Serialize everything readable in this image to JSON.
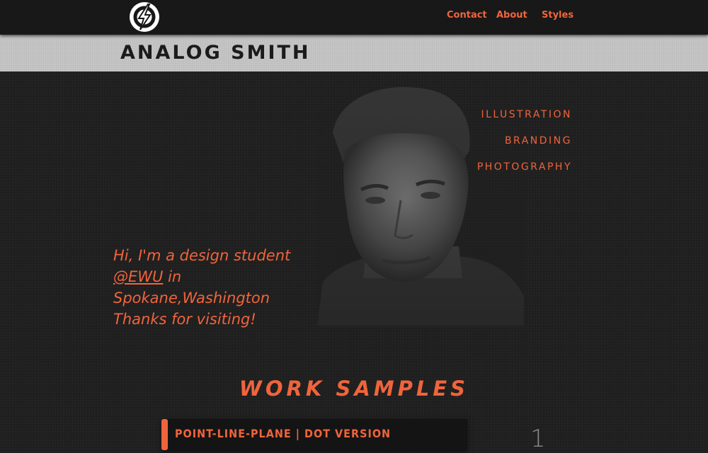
{
  "header": {
    "logo_icon": "lightning-bolt-circle-icon",
    "nav": [
      {
        "label": "Contact"
      },
      {
        "label": "About"
      },
      {
        "label": "Styles"
      }
    ]
  },
  "brand": {
    "title": "ANALOG SMITH"
  },
  "hero": {
    "portrait_icon": "portrait-photo",
    "links": [
      {
        "label": "ILLUSTRATION"
      },
      {
        "label": "BRANDING"
      },
      {
        "label": "PHOTOGRAPHY"
      }
    ],
    "intro": {
      "line1": "Hi, I'm a design student",
      "handle": "@EWU",
      "line2_rest": " in",
      "line3": "Spokane,Washington",
      "line4": "Thanks for visiting!"
    }
  },
  "work": {
    "title": "WORK SAMPLES",
    "items": [
      {
        "title": "POINT-LINE-PLANE | DOT VERSION",
        "number": "1"
      }
    ]
  },
  "colors": {
    "accent": "#f0643c",
    "background": "#1f1f1f",
    "topbar": "#181818",
    "brandbar": "#c6c6c6"
  }
}
